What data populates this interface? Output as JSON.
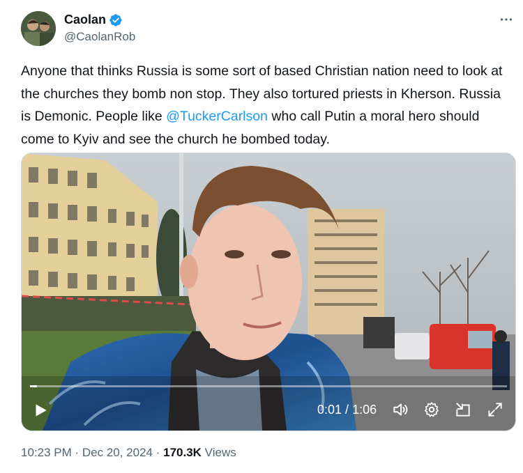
{
  "author": {
    "name": "Caolan",
    "handle": "@CaolanRob",
    "verified": true,
    "avatar_icon": "avatar-photo"
  },
  "more_icon": "more-horizontal-icon",
  "tweet": {
    "text_before": "Anyone that thinks Russia is some sort of based Christian nation need to look at the churches they bomb non stop. They also tortured priests in Kherson. Russia is Demonic. People like ",
    "mention": "@TuckerCarlson",
    "text_after": " who call Putin a moral hero should come to Kyiv and see the church he bombed today."
  },
  "video": {
    "current_time": "0:01",
    "separator": " / ",
    "duration": "1:06",
    "progress_fraction": 0.015,
    "controls": [
      "play-icon",
      "volume-icon",
      "settings-gear-icon",
      "exit-pip-icon",
      "fullscreen-icon"
    ]
  },
  "meta": {
    "time": "10:23 PM",
    "dot1": " · ",
    "date": "Dec 20, 2024",
    "dot2": " · ",
    "views_count": "170.3K",
    "views_label": " Views"
  },
  "colors": {
    "link": "#1d9bf0",
    "verified_badge": "#1d9bf0",
    "secondary_text": "#536471"
  }
}
